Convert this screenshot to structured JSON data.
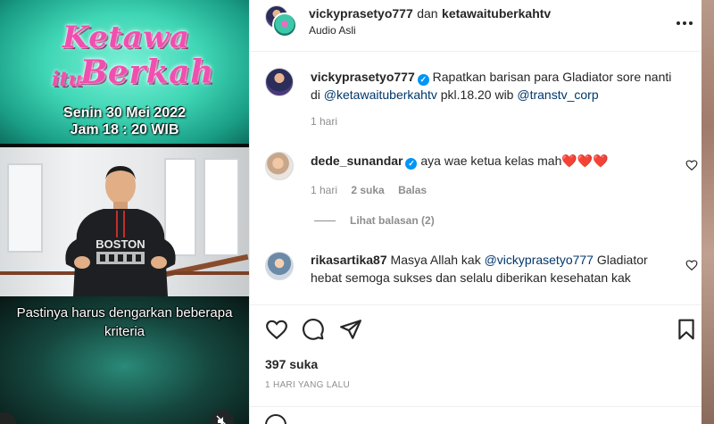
{
  "video": {
    "logo_line1": "Ketawa",
    "logo_itu": "itu",
    "logo_line2": "Berkah",
    "date_line": "Senin 30 Mei 2022",
    "time_line": "Jam 18 : 20 WIB",
    "shirt_text": "BOSTON",
    "caption_line1": "Pastinya harus dengarkan beberapa",
    "caption_line2": "kriteria"
  },
  "header": {
    "user1": "vickyprasetyo777",
    "connector": "dan",
    "user2": "ketawaituberkahtv",
    "audio": "Audio Asli",
    "more_icon": "more-horizontal-icon"
  },
  "caption_comment": {
    "username": "vickyprasetyo777",
    "text": "Rapatkan barisan para Gladiator sore nanti",
    "text_di": "di",
    "mention1": "@ketawaituberkahtv",
    "text_time": "pkl.18.20 wib",
    "mention2": "@transtv_corp",
    "time": "1 hari"
  },
  "comments": [
    {
      "username": "dede_sunandar",
      "verified": true,
      "text": "aya wae ketua kelas mah",
      "emoji": "❤️❤️❤️",
      "time": "1 hari",
      "likes": "2 suka",
      "reply": "Balas",
      "view_replies": "Lihat balasan (2)"
    },
    {
      "username": "rikasartika87",
      "verified": false,
      "text_before": "Masya Allah kak",
      "mention": "@vickyprasetyo777",
      "text_after": "Gladiator",
      "text_line2": "hebat semoga sukses dan selalu diberikan kesehatan kak"
    }
  ],
  "actions": {
    "like_icon": "heart-icon",
    "comment_icon": "comment-icon",
    "share_icon": "share-icon",
    "save_icon": "bookmark-icon",
    "likes": "397 suka",
    "date": "1 HARI YANG LALU"
  },
  "colors": {
    "verified": "#0095f6",
    "link": "#00376b",
    "muted": "#8e8e8e",
    "logo_pink": "#f04fb0"
  }
}
